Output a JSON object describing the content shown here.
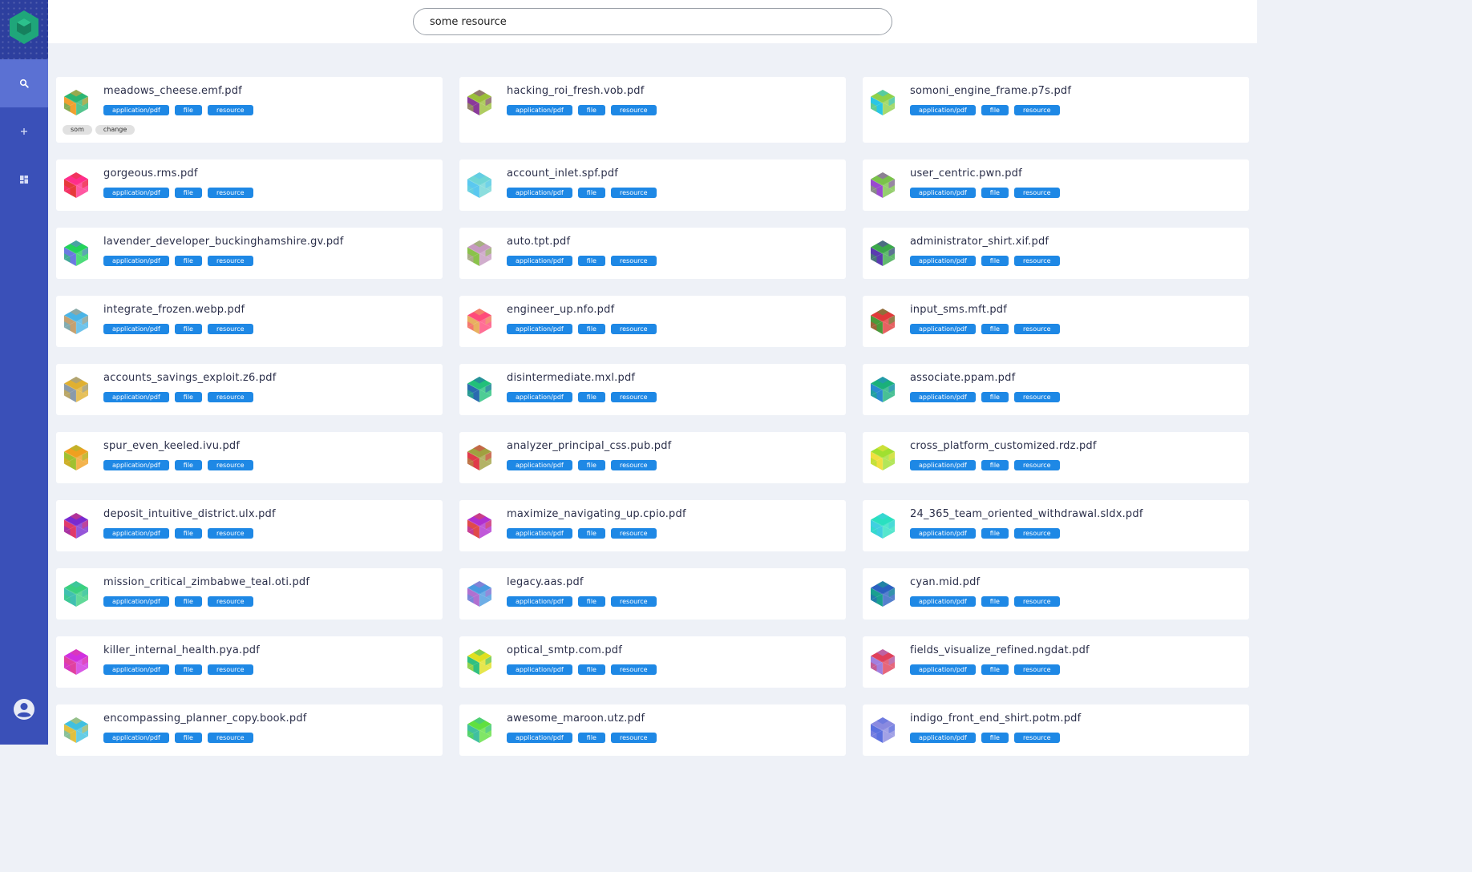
{
  "search": {
    "value": "some resource"
  },
  "nav": {
    "icons": [
      "search-icon",
      "plus-icon",
      "dashboard-icon"
    ],
    "user_icon": "account-circle-icon"
  },
  "colors": {
    "sidebar": "#3a50b8",
    "chip": "#1e88e5",
    "active_nav": "#5b71d3"
  },
  "chips": [
    "application/pdf",
    "file",
    "resource"
  ],
  "cards": [
    {
      "name": "meadows_cheese.emf.pdf",
      "c1": "#2bb673",
      "c2": "#f0a030",
      "tags": [
        "som",
        "change"
      ]
    },
    {
      "name": "hacking_roi_fresh.vob.pdf",
      "c1": "#9bbf3a",
      "c2": "#8a3a9a",
      "tags": []
    },
    {
      "name": "somoni_engine_frame.p7s.pdf",
      "c1": "#8fd14a",
      "c2": "#2ac6e6",
      "tags": []
    },
    {
      "name": "gorgeous.rms.pdf",
      "c1": "#ff2d8a",
      "c2": "#e63a3a",
      "tags": []
    },
    {
      "name": "account_inlet.spf.pdf",
      "c1": "#6fd6d6",
      "c2": "#5ac8f0",
      "tags": []
    },
    {
      "name": "user_centric.pwn.pdf",
      "c1": "#7ac24a",
      "c2": "#9a4ad0",
      "tags": []
    },
    {
      "name": "lavender_developer_buckinghamshire.gv.pdf",
      "c1": "#22d35a",
      "c2": "#6a7ae0",
      "tags": []
    },
    {
      "name": "auto.tpt.pdf",
      "c1": "#c69ac0",
      "c2": "#8ac24a",
      "tags": []
    },
    {
      "name": "administrator_shirt.xif.pdf",
      "c1": "#3aa84a",
      "c2": "#5a3ab0",
      "tags": []
    },
    {
      "name": "integrate_frozen.webp.pdf",
      "c1": "#4ab4e6",
      "c2": "#c4a070",
      "tags": []
    },
    {
      "name": "engineer_up.nfo.pdf",
      "c1": "#ff4a7a",
      "c2": "#e8b060",
      "tags": []
    },
    {
      "name": "input_sms.mft.pdf",
      "c1": "#e03a3a",
      "c2": "#4a9a3a",
      "tags": []
    },
    {
      "name": "accounts_savings_exploit.z6.pdf",
      "c1": "#e0b030",
      "c2": "#8a9aaa",
      "tags": []
    },
    {
      "name": "disintermediate.mxl.pdf",
      "c1": "#22c07a",
      "c2": "#2a6ab0",
      "tags": []
    },
    {
      "name": "associate.ppam.pdf",
      "c1": "#1ab07a",
      "c2": "#2a8ad0",
      "tags": []
    },
    {
      "name": "spur_even_keeled.ivu.pdf",
      "c1": "#f0a020",
      "c2": "#a0c030",
      "tags": []
    },
    {
      "name": "analyzer_principal_css.pub.pdf",
      "c1": "#a0a040",
      "c2": "#e03a4a",
      "tags": []
    },
    {
      "name": "cross_platform_customized.rdz.pdf",
      "c1": "#a0e030",
      "c2": "#f0e040",
      "tags": []
    },
    {
      "name": "deposit_intuitive_district.ulx.pdf",
      "c1": "#7a2ad0",
      "c2": "#e03a6a",
      "tags": []
    },
    {
      "name": "maximize_navigating_up.cpio.pdf",
      "c1": "#b030d0",
      "c2": "#e04a4a",
      "tags": []
    },
    {
      "name": "24_365_team_oriented_withdrawal.sldx.pdf",
      "c1": "#2ae0c0",
      "c2": "#40d0e0",
      "tags": []
    },
    {
      "name": "mission_critical_zimbabwe_teal.oti.pdf",
      "c1": "#3ad080",
      "c2": "#40c0b0",
      "tags": []
    },
    {
      "name": "legacy.aas.pdf",
      "c1": "#4a9ae0",
      "c2": "#b070d0",
      "tags": []
    },
    {
      "name": "cyan.mid.pdf",
      "c1": "#2a60c0",
      "c2": "#1aa090",
      "tags": []
    },
    {
      "name": "killer_internal_health.pya.pdf",
      "c1": "#d030e0",
      "c2": "#e040a0",
      "tags": []
    },
    {
      "name": "optical_smtp.com.pdf",
      "c1": "#e0e020",
      "c2": "#30c080",
      "tags": []
    },
    {
      "name": "fields_visualize_refined.ngdat.pdf",
      "c1": "#e0405a",
      "c2": "#a080e0",
      "tags": []
    },
    {
      "name": "encompassing_planner_copy.book.pdf",
      "c1": "#40c0e0",
      "c2": "#e0c040",
      "tags": []
    },
    {
      "name": "awesome_maroon.utz.pdf",
      "c1": "#60e040",
      "c2": "#40c0a0",
      "tags": []
    },
    {
      "name": "indigo_front_end_shirt.potm.pdf",
      "c1": "#8a8ae0",
      "c2": "#5a70e0",
      "tags": []
    }
  ]
}
